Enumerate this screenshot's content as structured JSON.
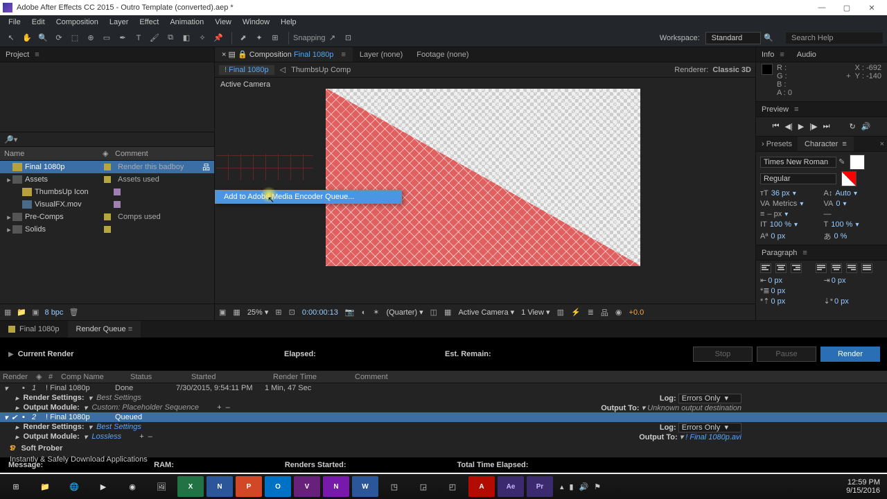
{
  "title": "Adobe After Effects CC 2015 - Outro Template (converted).aep *",
  "menu": [
    "File",
    "Edit",
    "Composition",
    "Layer",
    "Effect",
    "Animation",
    "View",
    "Window",
    "Help"
  ],
  "toolbar": {
    "snapping": "Snapping",
    "workspace_label": "Workspace:",
    "workspace_value": "Standard",
    "search_placeholder": "Search Help"
  },
  "project": {
    "tab": "Project",
    "headers": {
      "name": "Name",
      "comment": "Comment"
    },
    "items": [
      {
        "name": "Final 1080p",
        "type": "comp",
        "indent": 0,
        "comment": "Render this badboy",
        "label": "yellow",
        "selected": true
      },
      {
        "name": "Assets",
        "type": "folder",
        "indent": 0,
        "comment": "Assets used",
        "label": "yellow"
      },
      {
        "name": "ThumbsUp Icon",
        "type": "comp",
        "indent": 1,
        "label": "purple"
      },
      {
        "name": "VisualFX.mov",
        "type": "video",
        "indent": 1,
        "label": "purple"
      },
      {
        "name": "Pre-Comps",
        "type": "folder",
        "indent": 0,
        "comment": "Comps used",
        "label": "yellow"
      },
      {
        "name": "Solids",
        "type": "folder",
        "indent": 0,
        "label": "yellow"
      }
    ],
    "bpc": "8 bpc"
  },
  "comp_tabs": {
    "x": "×",
    "lock": "🔒",
    "prefix": "Composition",
    "name": "Final 1080p",
    "layer": "Layer (none)",
    "footage": "Footage (none)"
  },
  "mini_nav": {
    "current": "Final 1080p",
    "next": "ThumbsUp Comp",
    "renderer_label": "Renderer:",
    "renderer_value": "Classic 3D"
  },
  "viewport_label": "Active Camera",
  "context_menu": {
    "item": "Add to Adobe Media Encoder Queue..."
  },
  "view_controls": {
    "zoom": "25%",
    "timecode": "0:00:00:13",
    "quality": "(Quarter)",
    "camera": "Active Camera",
    "views": "1 View",
    "exposure": "+0.0"
  },
  "info": {
    "tab_info": "Info",
    "tab_audio": "Audio",
    "r": "R :",
    "g": "G :",
    "b": "B :",
    "a": "A : 0",
    "x": "X : -692",
    "y": "Y : -140"
  },
  "preview_tab": "Preview",
  "presets_label": "› Presets",
  "character": {
    "tab": "Character",
    "font": "Times New Roman",
    "style": "Regular",
    "size": "36 px",
    "leading": "Auto",
    "kern": "Metrics",
    "track": "0",
    "stroke": "– px",
    "v": "100 %",
    "h": "100 %",
    "baseline": "0 px",
    "tsume": "0 %"
  },
  "paragraph": {
    "tab": "Paragraph",
    "v": "0 px"
  },
  "lower_tabs": {
    "comp": "Final 1080p",
    "rq": "Render Queue"
  },
  "rq": {
    "current": "Current Render",
    "elapsed": "Elapsed:",
    "est": "Est. Remain:",
    "stop": "Stop",
    "pause": "Pause",
    "render": "Render",
    "cols": {
      "render": "Render",
      "num": "#",
      "comp": "Comp Name",
      "status": "Status",
      "started": "Started",
      "time": "Render Time",
      "comment": "Comment"
    },
    "items": [
      {
        "num": "1",
        "comp": "Final 1080p",
        "status": "Done",
        "started": "7/30/2015, 9:54:11 PM",
        "time": "1 Min, 47 Sec",
        "render_settings": "Best Settings",
        "output_module": "Custom: Placeholder Sequence",
        "log": "Errors Only",
        "output_to": "Unknown output destination",
        "out_muted": true
      },
      {
        "num": "2",
        "comp": "Final 1080p",
        "status": "Queued",
        "selected": true,
        "render_settings": "Best Settings",
        "output_module": "Lossless",
        "log": "Errors Only",
        "output_to": "Final 1080p.avi"
      }
    ],
    "labels": {
      "rs": "Render Settings:",
      "om": "Output Module:",
      "log": "Log:",
      "out": "Output To:"
    },
    "foot": {
      "msg": "Message:",
      "ram": "RAM:",
      "rs": "Renders Started:",
      "tte": "Total Time Elapsed:"
    }
  },
  "watermark": {
    "brand_a": "S",
    "brand_b": "P",
    "name": "Soft Prober",
    "sub": "Instantly & Safely Download Applications"
  },
  "taskbar_time": "12:59 PM",
  "taskbar_date": "9/15/2016"
}
